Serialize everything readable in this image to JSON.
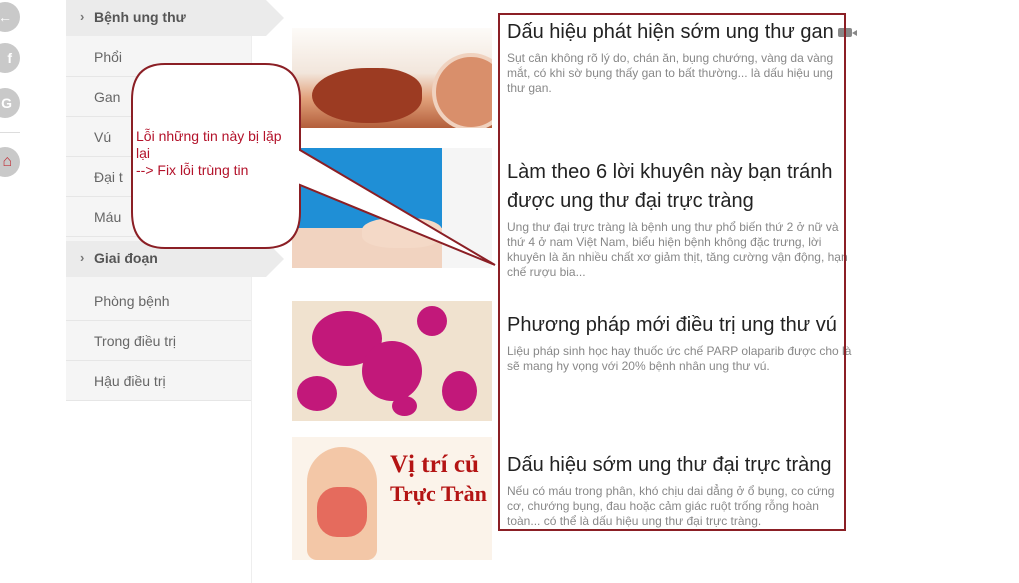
{
  "social": {
    "icons": [
      {
        "name": "back-icon",
        "glyph": "←"
      },
      {
        "name": "facebook-icon",
        "glyph": "f"
      },
      {
        "name": "google-icon",
        "glyph": "G"
      },
      {
        "name": "home-icon",
        "glyph": "⌂"
      }
    ]
  },
  "sidebar": {
    "section1": "Bệnh ung thư",
    "items1": [
      "Phổi",
      "Gan",
      "Vú",
      "Đại t",
      "Máu"
    ],
    "section2": "Giai đoạn",
    "items2": [
      "Phòng bệnh",
      "Trong điều trị",
      "Hậu điều trị"
    ]
  },
  "articles": [
    {
      "title": "Dấu hiệu phát hiện sớm ung thư gan",
      "desc": "Sụt cân không rõ lý do, chán ăn, bụng chướng, vàng da vàng mắt, có khi sờ bụng thấy gan to bất thường... là dấu hiệu ung thư gan."
    },
    {
      "title": "Làm theo 6 lời khuyên này bạn tránh được ung thư đại trực tràng",
      "desc": "Ung thư đại trực tràng là bệnh ung thư phổ biến thứ 2 ở nữ và thứ 4 ở nam Việt Nam, biểu hiện bệnh không đặc trưng, lời khuyên là ăn nhiều chất xơ giảm thịt, tăng cường vận động, hạn chế rượu bia..."
    },
    {
      "title": "Phương pháp mới điều trị ung thư vú",
      "desc": "Liệu pháp sinh học hay thuốc ức chế PARP olaparib được cho là sẽ mang hy vọng với 20% bệnh nhân ung thư vú."
    },
    {
      "title": "Dấu hiệu sớm ung thư đại trực tràng",
      "desc": "Nếu có máu trong phân, khó chịu dai dẳng ở ổ bụng, co cứng cơ, chướng bụng, đau hoặc cảm giác ruột trống rỗng hoàn toàn... có thể là dấu hiệu ung thư đại trực tràng."
    }
  ],
  "thumb4": {
    "line1": "Vị trí củ",
    "line2": "Trực Tràn"
  },
  "annotation": {
    "text": "Lỗi những tin này bị lặp lại\n--> Fix lỗi trùng tin",
    "color": "#b3122a"
  },
  "colors": {
    "highlight_border": "#8b1f25"
  }
}
